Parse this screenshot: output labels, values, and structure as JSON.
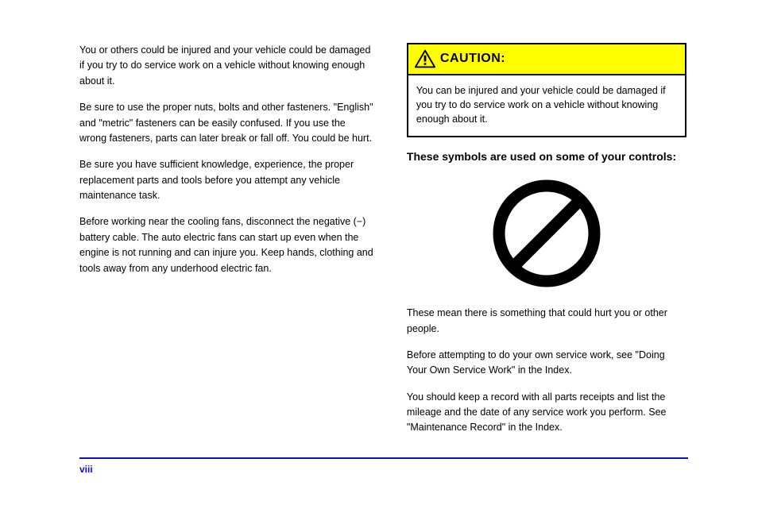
{
  "left": {
    "p1": "You or others could be injured and your vehicle could be damaged if you try to do service work on a vehicle without knowing enough about it.",
    "li1": "Be sure to use the proper nuts, bolts and other fasteners. \"English\" and \"metric\" fasteners can be easily confused. If you use the wrong fasteners, parts can later break or fall off. You could be hurt.",
    "li2": "Be sure you have sufficient knowledge, experience, the proper replacement parts and tools before you attempt any vehicle maintenance task.",
    "li3": "Before working near the cooling fans, disconnect the negative (−) battery cable. The auto electric fans can start up even when the engine is not running and can injure you. Keep hands, clothing and tools away from any underhood electric fan."
  },
  "caution": {
    "title": "CAUTION:",
    "body": "You can be injured and your vehicle could be damaged if you try to do service work on a vehicle without knowing enough about it."
  },
  "right": {
    "subhead": "These symbols are used on some of your controls:",
    "p_after": "These mean there is something that could hurt you or other people.",
    "p1": "Before attempting to do your own service work, see \"Doing Your Own Service Work\" in the Index.",
    "p2": "You should keep a record with all parts receipts and list the mileage and the date of any service work you perform. See \"Maintenance Record\" in the Index."
  },
  "footer": {
    "page": "viii",
    "blank": ""
  }
}
